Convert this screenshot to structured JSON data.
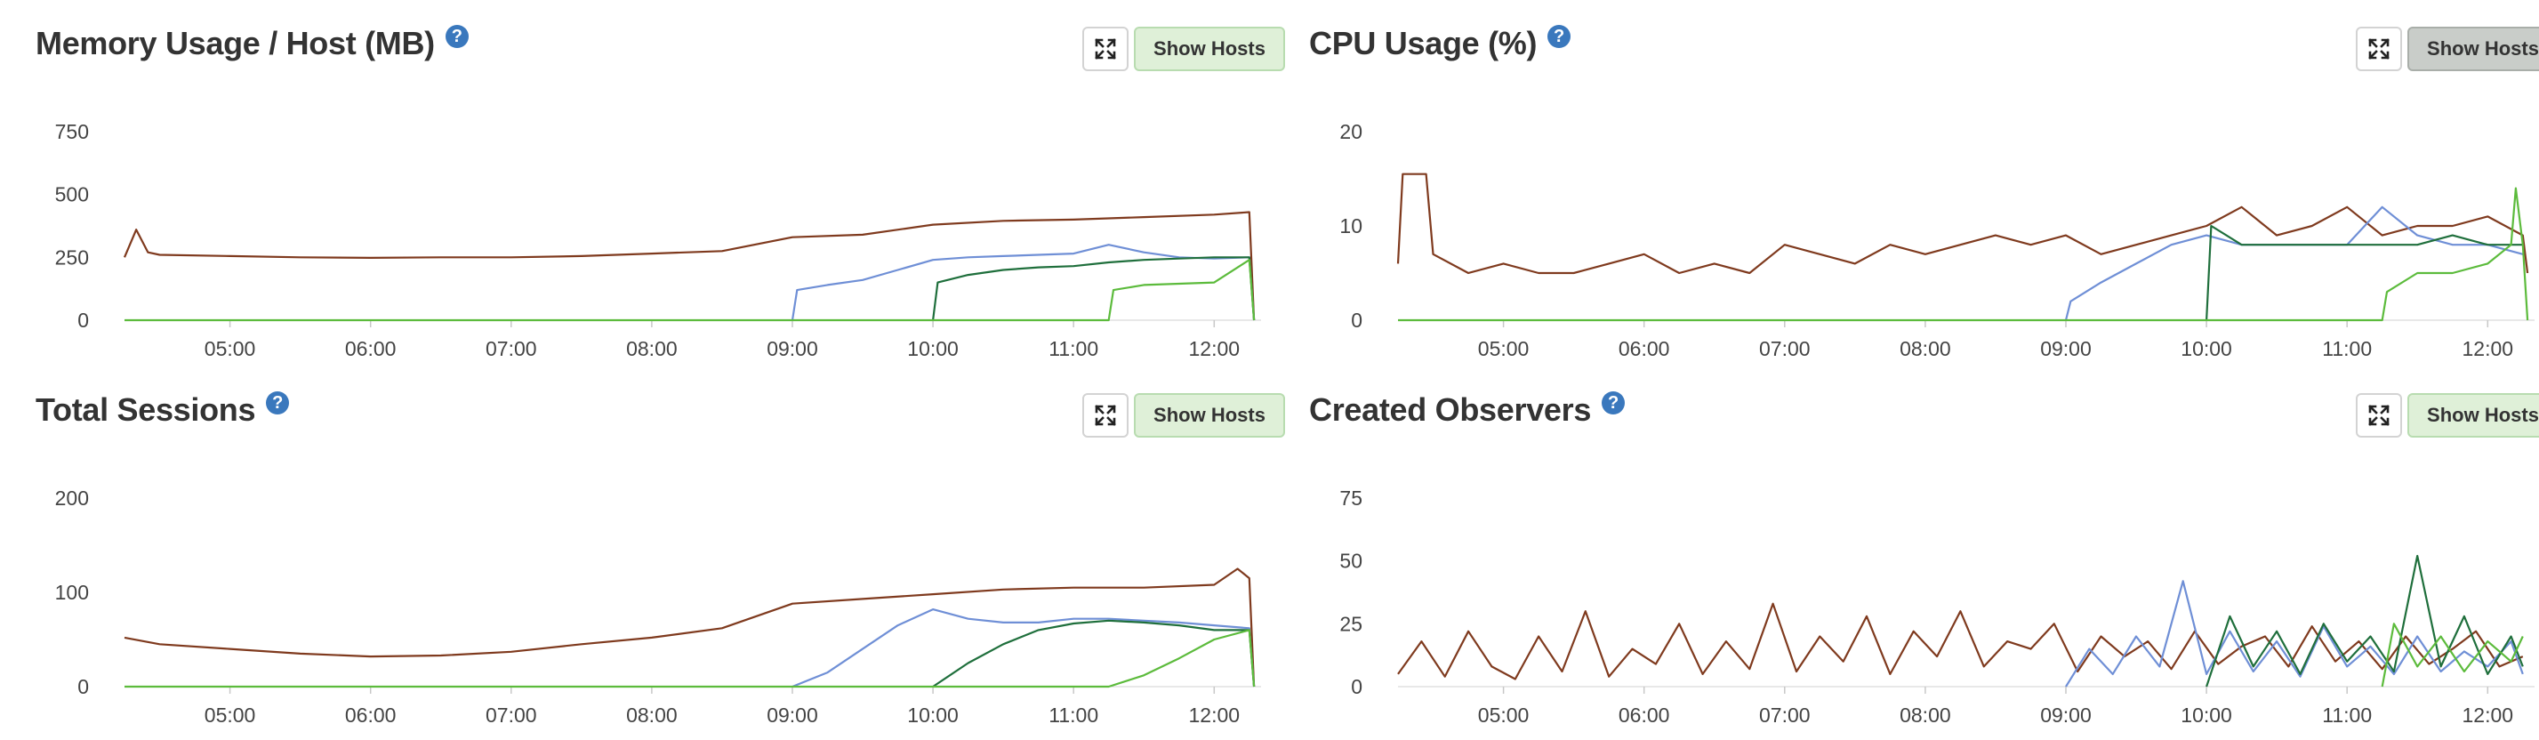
{
  "ui": {
    "help_glyph": "?",
    "show_hosts_label": "Show Hosts",
    "expand_icon": "expand-arrows-icon",
    "help_icon": "question-circle-icon",
    "colors": {
      "brown": "#7f3a1e",
      "blue": "#6f8fd6",
      "dark_green": "#1f6f3c",
      "green": "#5cbb3c",
      "help": "#3a78bd",
      "button_bg": "#dff0d8",
      "button_pressed_bg": "#c9cdc9"
    }
  },
  "chart_data": [
    {
      "type": "line",
      "title": "Memory Usage / Host (MB)",
      "show_hosts_pressed": false,
      "x_range": [
        "04:15",
        "12:20"
      ],
      "x_ticks": [
        "05:00",
        "06:00",
        "07:00",
        "08:00",
        "09:00",
        "10:00",
        "11:00",
        "12:00"
      ],
      "ylim": [
        0,
        750
      ],
      "y_ticks": [
        "0",
        "250",
        "500",
        "750"
      ],
      "series": [
        {
          "color": "#7f3a1e",
          "x": [
            "04:15",
            "04:20",
            "04:25",
            "04:30",
            "05:00",
            "05:30",
            "06:00",
            "06:30",
            "07:00",
            "07:30",
            "08:00",
            "08:30",
            "09:00",
            "09:30",
            "10:00",
            "10:30",
            "11:00",
            "11:30",
            "12:00",
            "12:15",
            "12:17"
          ],
          "values": [
            250,
            360,
            270,
            260,
            255,
            250,
            248,
            250,
            250,
            255,
            265,
            275,
            330,
            340,
            380,
            395,
            400,
            410,
            420,
            430,
            0
          ]
        },
        {
          "color": "#6f8fd6",
          "x": [
            "09:00",
            "09:02",
            "09:15",
            "09:30",
            "09:45",
            "10:00",
            "10:15",
            "10:30",
            "10:45",
            "11:00",
            "11:15",
            "11:30",
            "11:45",
            "12:00",
            "12:15",
            "12:17"
          ],
          "values": [
            0,
            120,
            140,
            160,
            200,
            240,
            250,
            255,
            260,
            265,
            300,
            270,
            250,
            245,
            250,
            0
          ]
        },
        {
          "color": "#1f6f3c",
          "x": [
            "10:00",
            "10:02",
            "10:15",
            "10:30",
            "10:45",
            "11:00",
            "11:15",
            "11:30",
            "11:45",
            "12:00",
            "12:15",
            "12:17"
          ],
          "values": [
            0,
            150,
            180,
            200,
            210,
            215,
            230,
            240,
            245,
            250,
            250,
            0
          ]
        },
        {
          "color": "#5cbb3c",
          "x": [
            "04:15",
            "11:15",
            "11:17",
            "11:30",
            "11:45",
            "12:00",
            "12:15",
            "12:17"
          ],
          "values": [
            0,
            0,
            120,
            140,
            145,
            150,
            240,
            0
          ]
        }
      ]
    },
    {
      "type": "line",
      "title": "CPU Usage (%)",
      "show_hosts_pressed": true,
      "x_range": [
        "04:15",
        "12:20"
      ],
      "x_ticks": [
        "05:00",
        "06:00",
        "07:00",
        "08:00",
        "09:00",
        "10:00",
        "11:00",
        "12:00"
      ],
      "ylim": [
        0,
        20
      ],
      "y_ticks": [
        "0",
        "10",
        "20"
      ],
      "series": [
        {
          "color": "#7f3a1e",
          "x": [
            "04:15",
            "04:17",
            "04:20",
            "04:27",
            "04:30",
            "04:45",
            "05:00",
            "05:15",
            "05:30",
            "05:45",
            "06:00",
            "06:15",
            "06:30",
            "06:45",
            "07:00",
            "07:15",
            "07:30",
            "07:45",
            "08:00",
            "08:15",
            "08:30",
            "08:45",
            "09:00",
            "09:15",
            "09:30",
            "09:45",
            "10:00",
            "10:15",
            "10:30",
            "10:45",
            "11:00",
            "11:15",
            "11:30",
            "11:45",
            "12:00",
            "12:15",
            "12:17"
          ],
          "values": [
            6,
            15.5,
            15.5,
            15.5,
            7,
            5,
            6,
            5,
            5,
            6,
            7,
            5,
            6,
            5,
            8,
            7,
            6,
            8,
            7,
            8,
            9,
            8,
            9,
            7,
            8,
            9,
            10,
            12,
            9,
            10,
            12,
            9,
            10,
            10,
            11,
            9,
            5
          ]
        },
        {
          "color": "#6f8fd6",
          "x": [
            "09:00",
            "09:02",
            "09:15",
            "09:30",
            "09:45",
            "10:00",
            "10:15",
            "10:30",
            "10:45",
            "11:00",
            "11:15",
            "11:30",
            "11:45",
            "12:00",
            "12:15"
          ],
          "values": [
            0,
            2,
            4,
            6,
            8,
            9,
            8,
            8,
            8,
            8,
            12,
            9,
            8,
            8,
            7
          ]
        },
        {
          "color": "#1f6f3c",
          "x": [
            "10:00",
            "10:02",
            "10:15",
            "10:30",
            "10:45",
            "11:00",
            "11:15",
            "11:30",
            "11:45",
            "12:00",
            "12:15"
          ],
          "values": [
            0,
            10,
            8,
            8,
            8,
            8,
            8,
            8,
            9,
            8,
            8
          ]
        },
        {
          "color": "#5cbb3c",
          "x": [
            "04:15",
            "11:15",
            "11:17",
            "11:30",
            "11:45",
            "12:00",
            "12:10",
            "12:12",
            "12:15",
            "12:17"
          ],
          "values": [
            0,
            0,
            3,
            5,
            5,
            6,
            8,
            14,
            8,
            0
          ]
        }
      ]
    },
    {
      "type": "line",
      "title": "Total Sessions",
      "show_hosts_pressed": false,
      "x_range": [
        "04:15",
        "12:20"
      ],
      "x_ticks": [
        "05:00",
        "06:00",
        "07:00",
        "08:00",
        "09:00",
        "10:00",
        "11:00",
        "12:00"
      ],
      "ylim": [
        0,
        200
      ],
      "y_ticks": [
        "0",
        "100",
        "200"
      ],
      "series": [
        {
          "color": "#7f3a1e",
          "x": [
            "04:15",
            "04:30",
            "05:00",
            "05:30",
            "06:00",
            "06:30",
            "07:00",
            "07:30",
            "08:00",
            "08:30",
            "09:00",
            "09:30",
            "10:00",
            "10:30",
            "11:00",
            "11:30",
            "12:00",
            "12:10",
            "12:15",
            "12:17"
          ],
          "values": [
            52,
            45,
            40,
            35,
            32,
            33,
            37,
            45,
            52,
            62,
            88,
            93,
            98,
            103,
            105,
            105,
            108,
            125,
            115,
            0
          ]
        },
        {
          "color": "#6f8fd6",
          "x": [
            "09:00",
            "09:15",
            "09:30",
            "09:45",
            "10:00",
            "10:15",
            "10:30",
            "10:45",
            "11:00",
            "11:15",
            "11:30",
            "11:45",
            "12:00",
            "12:15",
            "12:17"
          ],
          "values": [
            0,
            15,
            40,
            65,
            82,
            72,
            68,
            68,
            72,
            72,
            70,
            68,
            65,
            62,
            0
          ]
        },
        {
          "color": "#1f6f3c",
          "x": [
            "10:00",
            "10:15",
            "10:30",
            "10:45",
            "11:00",
            "11:15",
            "11:30",
            "11:45",
            "12:00",
            "12:15",
            "12:17"
          ],
          "values": [
            0,
            25,
            45,
            60,
            67,
            70,
            68,
            65,
            60,
            60,
            0
          ]
        },
        {
          "color": "#5cbb3c",
          "x": [
            "04:15",
            "11:15",
            "11:30",
            "11:45",
            "12:00",
            "12:15",
            "12:17"
          ],
          "values": [
            0,
            0,
            12,
            30,
            50,
            60,
            0
          ]
        }
      ]
    },
    {
      "type": "line",
      "title": "Created Observers",
      "show_hosts_pressed": false,
      "x_range": [
        "04:15",
        "12:20"
      ],
      "x_ticks": [
        "05:00",
        "06:00",
        "07:00",
        "08:00",
        "09:00",
        "10:00",
        "11:00",
        "12:00"
      ],
      "ylim": [
        0,
        75
      ],
      "y_ticks": [
        "0",
        "25",
        "50",
        "75"
      ],
      "series": [
        {
          "color": "#7f3a1e",
          "x": [
            "04:15",
            "04:25",
            "04:35",
            "04:45",
            "04:55",
            "05:05",
            "05:15",
            "05:25",
            "05:35",
            "05:45",
            "05:55",
            "06:05",
            "06:15",
            "06:25",
            "06:35",
            "06:45",
            "06:55",
            "07:05",
            "07:15",
            "07:25",
            "07:35",
            "07:45",
            "07:55",
            "08:05",
            "08:15",
            "08:25",
            "08:35",
            "08:45",
            "08:55",
            "09:05",
            "09:15",
            "09:25",
            "09:35",
            "09:45",
            "09:55",
            "10:05",
            "10:15",
            "10:25",
            "10:35",
            "10:45",
            "10:55",
            "11:05",
            "11:15",
            "11:25",
            "11:35",
            "11:45",
            "11:55",
            "12:05",
            "12:15"
          ],
          "values": [
            5,
            18,
            4,
            22,
            8,
            3,
            20,
            6,
            30,
            4,
            15,
            9,
            25,
            5,
            18,
            7,
            33,
            6,
            20,
            10,
            28,
            5,
            22,
            12,
            30,
            8,
            18,
            15,
            25,
            6,
            20,
            12,
            18,
            7,
            22,
            9,
            16,
            20,
            8,
            24,
            10,
            18,
            7,
            20,
            9,
            15,
            22,
            8,
            12
          ]
        },
        {
          "color": "#6f8fd6",
          "x": [
            "09:00",
            "09:10",
            "09:20",
            "09:30",
            "09:40",
            "09:50",
            "10:00",
            "10:10",
            "10:20",
            "10:30",
            "10:40",
            "10:50",
            "11:00",
            "11:10",
            "11:20",
            "11:30",
            "11:40",
            "11:50",
            "12:00",
            "12:10",
            "12:15"
          ],
          "values": [
            0,
            15,
            5,
            20,
            8,
            42,
            5,
            22,
            6,
            18,
            4,
            24,
            8,
            16,
            5,
            20,
            6,
            14,
            8,
            18,
            5
          ]
        },
        {
          "color": "#1f6f3c",
          "x": [
            "10:00",
            "10:10",
            "10:20",
            "10:30",
            "10:40",
            "10:50",
            "11:00",
            "11:10",
            "11:20",
            "11:30",
            "11:40",
            "11:50",
            "12:00",
            "12:10",
            "12:15"
          ],
          "values": [
            0,
            28,
            8,
            22,
            5,
            25,
            10,
            20,
            6,
            52,
            8,
            28,
            5,
            20,
            8
          ]
        },
        {
          "color": "#5cbb3c",
          "x": [
            "11:15",
            "11:20",
            "11:30",
            "11:40",
            "11:50",
            "12:00",
            "12:10",
            "12:15"
          ],
          "values": [
            0,
            25,
            8,
            20,
            6,
            18,
            10,
            20
          ]
        }
      ]
    }
  ]
}
